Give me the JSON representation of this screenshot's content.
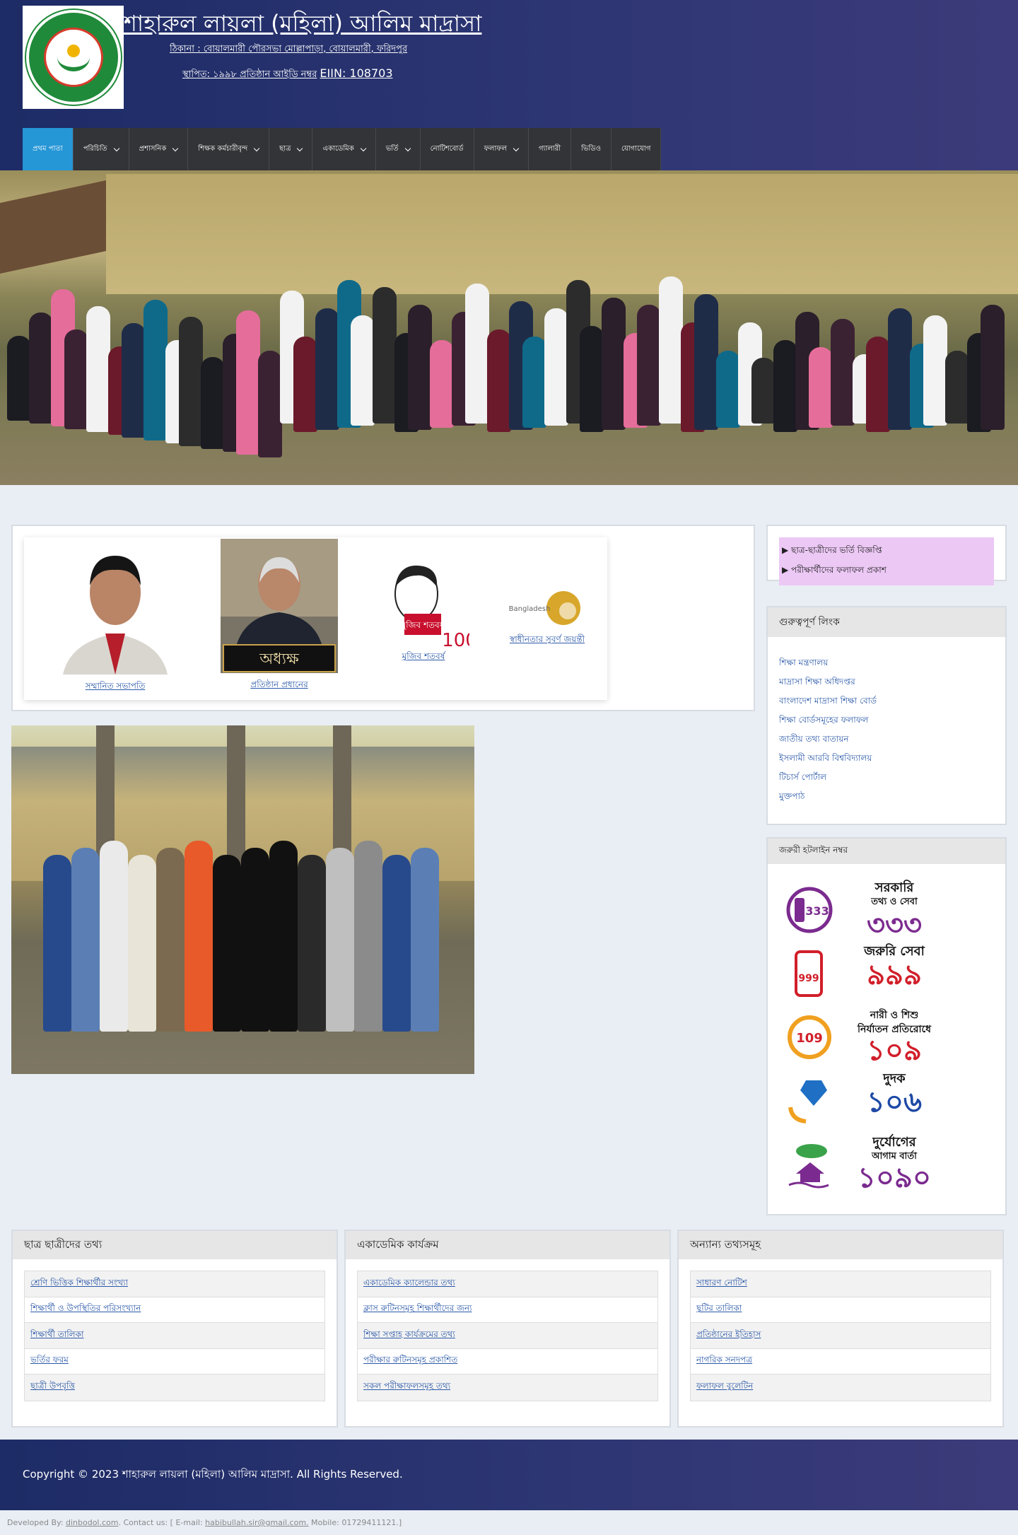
{
  "header": {
    "title": "শাহারুল লায়লা (মহিলা) আলিম মাদ্রাসা",
    "address": "ঠিকানা : বোয়ালমারী পৌরসভা মোল্লাপাড়া, বোয়ালমারী, ফরিদপুর",
    "estd_label": "স্থাপিত: ১৯৯৮ প্রতিষ্ঠান আইডি নম্বর",
    "eiin": "EIIN: 108703",
    "logo_text": "শাহারুল লায়লা আলিম মাদ্রাসা বোয়ালমারী, ফরিদপুর"
  },
  "nav": {
    "items": [
      {
        "label": "প্রথম পাতা",
        "dropdown": false,
        "active": true
      },
      {
        "label": "পরিচিতি",
        "dropdown": true
      },
      {
        "label": "প্রশাসনিক",
        "dropdown": true
      },
      {
        "label": "শিক্ষক কর্মচারীবৃন্দ",
        "dropdown": true
      },
      {
        "label": "ছাত্র",
        "dropdown": true
      },
      {
        "label": "একাডেমিক",
        "dropdown": true
      },
      {
        "label": "ভর্তি",
        "dropdown": true
      },
      {
        "label": "নোটিশবোর্ড",
        "dropdown": false
      },
      {
        "label": "ফলাফল",
        "dropdown": true
      },
      {
        "label": "গ্যালারী",
        "dropdown": false
      },
      {
        "label": "ভিডিও",
        "dropdown": false
      },
      {
        "label": "যোগাযোগ",
        "dropdown": false
      }
    ]
  },
  "leaders": [
    {
      "label": "সম্মানিত সভাপতি"
    },
    {
      "label": "প্রতিষ্ঠান প্রধানের"
    },
    {
      "label": "মুজিব শতবর্ষ"
    },
    {
      "label": "স্বাধীনতার সুবর্ণ জয়ন্তী"
    }
  ],
  "principal_plaque": "অধ্যক্ষ",
  "mujib_text": "মুজিব শতবর্ষ",
  "notices": [
    "▶ ছাত্র-ছাত্রীদের ভর্তি বিজ্ঞপ্তি",
    "▶ পরীক্ষার্থীদের ফলাফল প্রকাশ"
  ],
  "important_links": {
    "title": "গুরুত্বপূর্ণ লিংক",
    "items": [
      "শিক্ষা মন্ত্রণালয়",
      "মাদ্রাসা শিক্ষা অধিদপ্তর",
      "বাংলাদেশ মাদ্রাসা শিক্ষা বোর্ড",
      "শিক্ষা বোর্ডসমূহের ফলাফল",
      "জাতীয় তথ্য বাতায়ন",
      "ইসলামী আরবি বিশ্ববিদ্যালয়",
      "টিচার্স পোর্টাল",
      "মুক্তপাঠ"
    ]
  },
  "hotlines": {
    "title": "জরুরী হটলাইন নম্বর",
    "items": [
      {
        "t1": "সরকারি",
        "t1b": "তথ্য ও সেবা",
        "num": "৩৩৩",
        "color": "#7b2b8f",
        "icon": "phone-333-icon"
      },
      {
        "t1": "জরুরি সেবা",
        "t1b": "",
        "num": "৯৯৯",
        "color": "#d11f2a",
        "icon": "emergency-999-icon"
      },
      {
        "t1": "নারী ও শিশু",
        "t1b": "নির্যাতন প্রতিরোধে",
        "num": "১০৯",
        "color": "#d11f2a",
        "icon": "helpline-109-icon"
      },
      {
        "t1": "দুদক",
        "t1b": "",
        "num": "১০৬",
        "color": "#1f4aa5",
        "icon": "acc-106-icon"
      },
      {
        "t1": "দুর্যোগের",
        "t1b": "আগাম বার্তা",
        "num": "১০৯০",
        "color": "#7b2b8f",
        "icon": "disaster-1090-icon"
      }
    ]
  },
  "boxes": [
    {
      "title": "ছাত্র ছাত্রীদের তথ্য",
      "items": [
        "শ্রেণি ভিত্তিক শিক্ষার্থীর সংখ্যা",
        "শিক্ষার্থী ও উপস্থিতির পরিসংখ্যান",
        "শিক্ষার্থী তালিকা",
        "ভর্তির ফরম",
        "ছাত্রী উপবৃত্তি"
      ]
    },
    {
      "title": "একাডেমিক কার্যক্রম",
      "items": [
        "একাডেমিক ক্যালেন্ডার তথ্য",
        "ক্লাস রুটিনসমূহ শিক্ষার্থীদের জন্য",
        "শিক্ষা সপ্তাহ কার্যক্রমের তথ্য",
        "পরীক্ষার রুটিনসমূহ প্রকাশিত",
        "সকল পরীক্ষাফলসমূহ তথ্য"
      ]
    },
    {
      "title": "অন্যান্য তথ্যসমূহ",
      "items": [
        "সাধারণ নোটিশ",
        "ছুটির তালিকা",
        "প্রতিষ্ঠানের ইতিহাস",
        "নাগরিক সনদপত্র",
        "ফলাফল বুলেটিন"
      ]
    }
  ],
  "footer": {
    "copyright": "Copyright © 2023 শাহারুল লায়লা (মহিলা) আলিম মাদ্রাসা. All Rights Reserved.",
    "developed_by": "Developed By:",
    "dev_link": "dinbodol.com",
    "contact": ". Contact us: [ E-mail:",
    "email": "habibullah.sir@gmail.com.",
    "mobile": "Mobile: 01729411121.]"
  }
}
